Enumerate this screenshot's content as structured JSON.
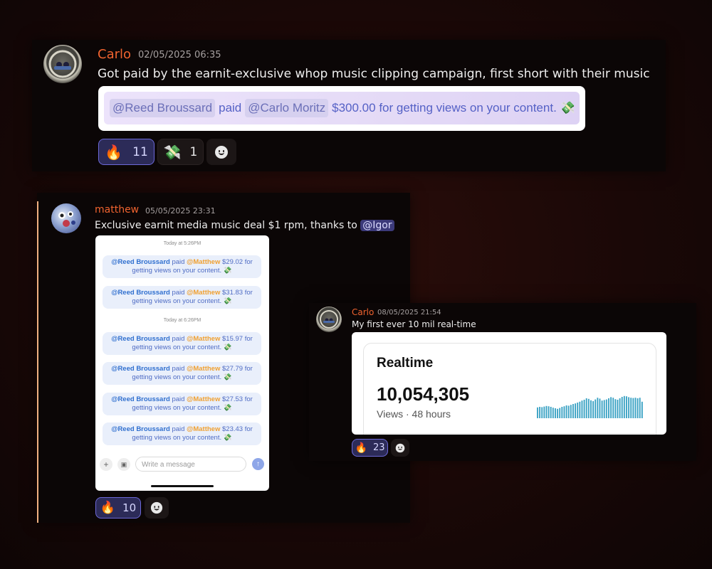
{
  "messages": [
    {
      "author": "Carlo",
      "timestamp": "02/05/2025 06:35",
      "text": "Got paid by the earnit-exclusive whop music clipping campaign, first short with their music",
      "embed": {
        "payer": "@Reed Broussard",
        "verb": "paid",
        "payee": "@Carlo  Moritz",
        "rest": "$300.00 for getting views on your content. 💸"
      },
      "reactions": [
        {
          "emoji": "🔥",
          "count": "11",
          "active": true
        },
        {
          "emoji": "💸",
          "count": "1",
          "active": false
        }
      ]
    },
    {
      "author": "matthew",
      "timestamp": "05/05/2025 23:31",
      "text_before": "Exclusive earnit media music deal $1 rpm, thanks to",
      "mention": "@Igor",
      "screenshot": {
        "day1": "Today at 5:26PM",
        "day2": "Today at 6:26PM",
        "payer": "@Reed Broussard",
        "verb": "paid",
        "payee": "@Matthew",
        "suffix": "getting views on your content. 💸",
        "payments": [
          {
            "amount": "$29.02 for"
          },
          {
            "amount": "$31.83 for"
          },
          {
            "amount": "$15.97 for"
          },
          {
            "amount": "$27.79 for"
          },
          {
            "amount": "$27.53 for"
          },
          {
            "amount": "$23.43 for"
          }
        ],
        "compose_placeholder": "Write a message"
      },
      "reactions": [
        {
          "emoji": "🔥",
          "count": "10",
          "active": true
        }
      ]
    },
    {
      "author": "Carlo",
      "timestamp": "08/05/2025 21:54",
      "text": "My first ever 10 mil real-time",
      "realtime": {
        "title": "Realtime",
        "value": "10,054,305",
        "subtitle": "Views · 48 hours",
        "bar_color": "#3aa2c4",
        "bars": [
          0.38,
          0.4,
          0.39,
          0.41,
          0.43,
          0.42,
          0.4,
          0.37,
          0.35,
          0.33,
          0.36,
          0.4,
          0.42,
          0.45,
          0.44,
          0.47,
          0.5,
          0.52,
          0.55,
          0.58,
          0.62,
          0.65,
          0.7,
          0.68,
          0.63,
          0.6,
          0.66,
          0.72,
          0.69,
          0.62,
          0.64,
          0.66,
          0.7,
          0.74,
          0.72,
          0.67,
          0.65,
          0.7,
          0.75,
          0.78,
          0.77,
          0.74,
          0.72,
          0.71,
          0.72,
          0.7,
          0.72,
          0.58
        ]
      },
      "reactions": [
        {
          "emoji": "🔥",
          "count": "23",
          "active": true
        }
      ]
    }
  ],
  "colors": {
    "username": "#f0632f",
    "accent_border": "#f0b080",
    "reaction_active_border": "#6c68d8"
  }
}
